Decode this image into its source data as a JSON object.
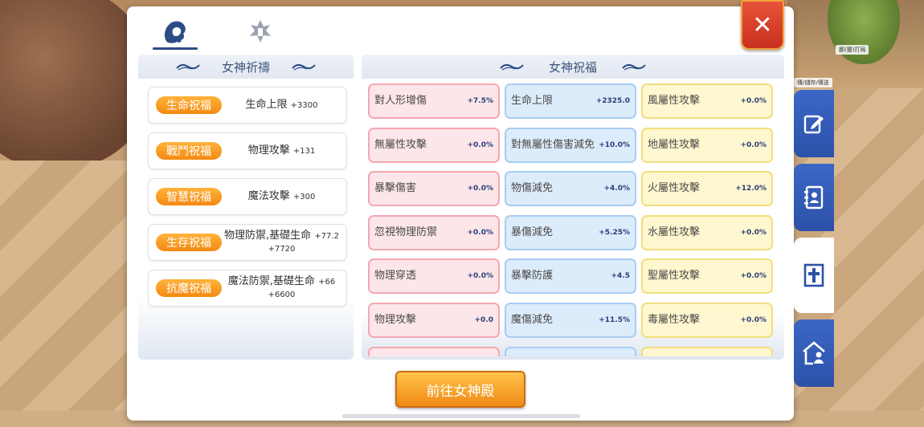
{
  "background": {
    "tag_1": "鄙(獵)打局",
    "tag_2": "傳/儲存/傳送"
  },
  "tabs": [
    {
      "name": "goddess",
      "icon": "goddess-head-icon",
      "active": true
    },
    {
      "name": "tower",
      "icon": "tower-emblem-icon",
      "active": false
    }
  ],
  "close_label": "✕",
  "prayer": {
    "title": "女神祈禱",
    "items": [
      {
        "badge": "生命祝福",
        "stat": "生命上限",
        "value": "+3300",
        "extra": ""
      },
      {
        "badge": "戰鬥祝福",
        "stat": "物理攻擊",
        "value": "+131",
        "extra": ""
      },
      {
        "badge": "智慧祝福",
        "stat": "魔法攻擊",
        "value": "+300",
        "extra": ""
      },
      {
        "badge": "生存祝福",
        "stat": "物理防禦,基礎生命",
        "value": "+77.2",
        "extra": "+7720"
      },
      {
        "badge": "抗魔祝福",
        "stat": "魔法防禦,基礎生命",
        "value": "+66",
        "extra": "+6600"
      }
    ]
  },
  "blessing": {
    "title": "女神祝福",
    "columns": [
      [
        {
          "name": "對人形增傷",
          "value": "+7.5%"
        },
        {
          "name": "無屬性攻擊",
          "value": "+0.0%"
        },
        {
          "name": "暴擊傷害",
          "value": "+0.0%"
        },
        {
          "name": "忽視物理防禦",
          "value": "+0.0%"
        },
        {
          "name": "物理穿透",
          "value": "+0.0%"
        },
        {
          "name": "物理攻擊",
          "value": "+0.0"
        },
        {
          "name": "",
          "value": ""
        }
      ],
      [
        {
          "name": "生命上限",
          "value": "+2325.0"
        },
        {
          "name": "對無屬性傷害減免",
          "value": "+10.0%"
        },
        {
          "name": "物傷減免",
          "value": "+4.0%"
        },
        {
          "name": "暴傷減免",
          "value": "+5.25%"
        },
        {
          "name": "暴擊防護",
          "value": "+4.5"
        },
        {
          "name": "魔傷減免",
          "value": "+11.5%"
        },
        {
          "name": "",
          "value": ""
        }
      ],
      [
        {
          "name": "風屬性攻擊",
          "value": "+0.0%"
        },
        {
          "name": "地屬性攻擊",
          "value": "+0.0%"
        },
        {
          "name": "火屬性攻擊",
          "value": "+12.0%"
        },
        {
          "name": "水屬性攻擊",
          "value": "+0.0%"
        },
        {
          "name": "聖屬性攻擊",
          "value": "+0.0%"
        },
        {
          "name": "毒屬性攻擊",
          "value": "+0.0%"
        },
        {
          "name": "",
          "value": ""
        }
      ]
    ],
    "column_colors": [
      "#f4a8b2",
      "#a7cdf2",
      "#f2de7c"
    ]
  },
  "go_button": "前往女神殿",
  "side_nav": [
    {
      "icon": "edit-icon",
      "active": false
    },
    {
      "icon": "contacts-book-icon",
      "active": false
    },
    {
      "icon": "cross-shrine-icon",
      "active": true
    },
    {
      "icon": "house-person-icon",
      "active": false
    }
  ]
}
